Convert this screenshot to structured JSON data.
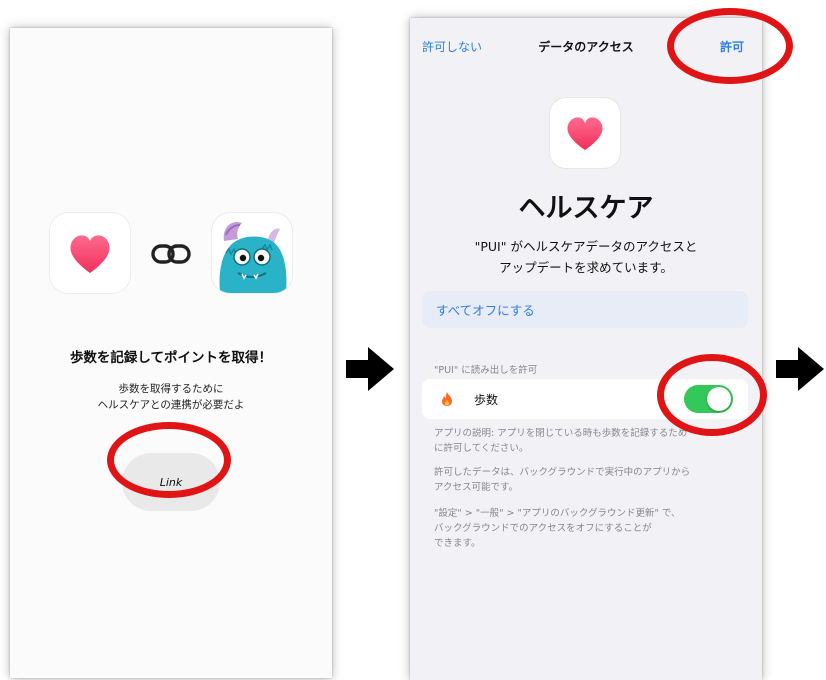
{
  "screen_left": {
    "headline": "歩数を記録してポイントを取得！",
    "sub_line_1": "歩数を取得するために",
    "sub_line_2": "ヘルスケアとの連携が必要だよ",
    "link_button": "Link",
    "icons": [
      "heart-icon",
      "link-icon",
      "monster-avatar"
    ]
  },
  "screen_right": {
    "nav": {
      "deny": "許可しない",
      "title": "データのアクセス",
      "allow": "許可"
    },
    "app_title": "ヘルスケア",
    "desc_line_1": "\"PUI\" がヘルスケアデータのアクセスと",
    "desc_line_2": "アップデートを求めています。",
    "turn_all_off": "すべてオフにする",
    "section_header": "\"PUI\" に読み出しを許可",
    "steps_label": "歩数",
    "steps_toggle_on": true,
    "fine_1_line_1": "アプリの説明: アプリを閉じている時も歩数を記録するため",
    "fine_1_line_2": "に許可してください。",
    "fine_2_line_1": "許可したデータは、バックグラウンドで実行中のアプリから",
    "fine_2_line_2": "アクセス可能です。",
    "fine_3_line_1": "\"設定\" > \"一般\" > \"アプリのバックグラウンド更新\" で、",
    "fine_3_line_2": "バックグラウンドでのアクセスをオフにすることが",
    "fine_3_line_3": "できます。"
  },
  "colors": {
    "highlight_ring": "#e01414",
    "ios_blue": "#2f7fe4",
    "toggle_on": "#34c759",
    "heart_top": "#ff5f8a",
    "heart_bottom": "#f0305a"
  }
}
